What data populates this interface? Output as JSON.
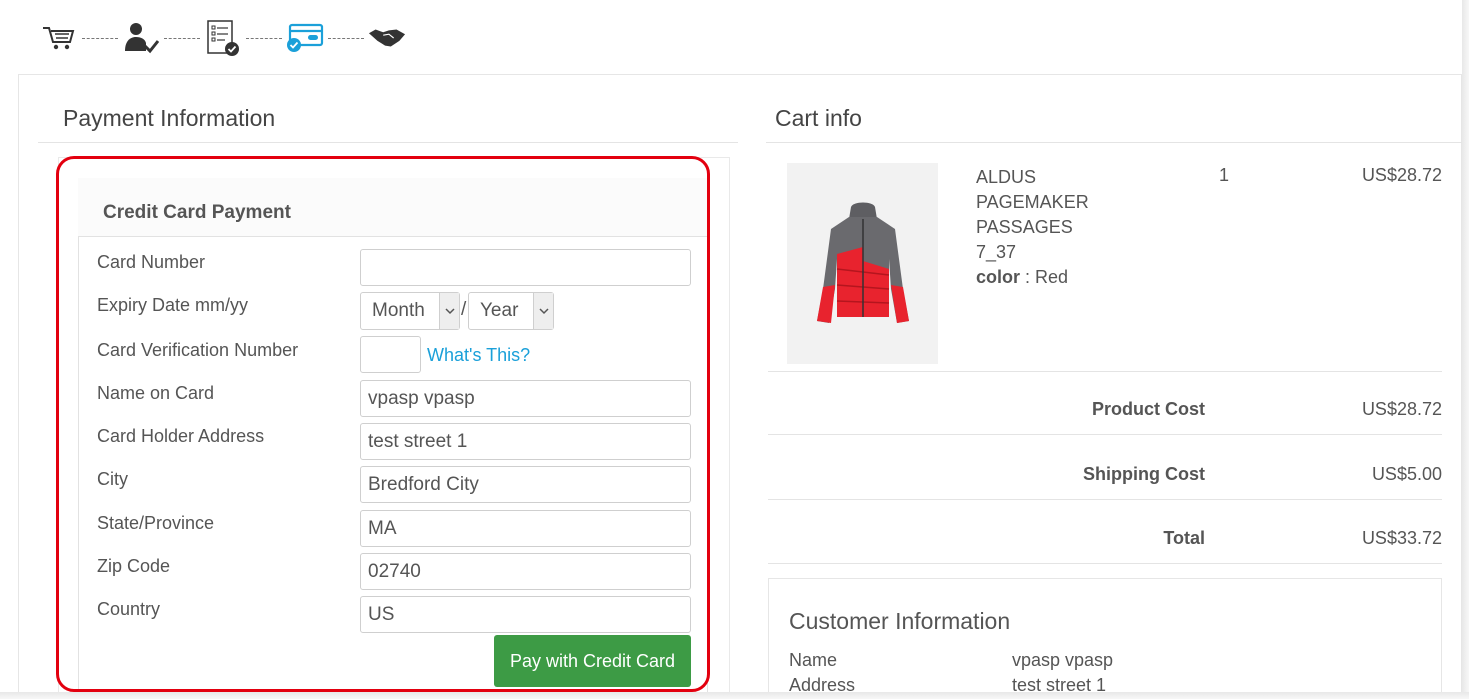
{
  "steps": [
    {
      "icon": "cart-icon"
    },
    {
      "icon": "user-check-icon"
    },
    {
      "icon": "checklist-icon"
    },
    {
      "icon": "credit-card-check-icon",
      "active": true
    },
    {
      "icon": "handshake-icon"
    }
  ],
  "colors": {
    "accent_blue": "#1ba0d9",
    "pay_button": "#3d9b45",
    "highlight_red": "#e3000f"
  },
  "payment": {
    "title": "Payment Information",
    "card_title": "Credit Card Payment",
    "fields": {
      "card_number": {
        "label": "Card Number",
        "value": ""
      },
      "expiry": {
        "label": "Expiry Date mm/yy",
        "month": "Month",
        "year": "Year",
        "separator": "/"
      },
      "cvv": {
        "label": "Card Verification Number",
        "value": "",
        "help_link": "What's This?"
      },
      "name": {
        "label": "Name on Card",
        "value": "vpasp vpasp"
      },
      "address": {
        "label": "Card Holder Address",
        "value": "test street 1"
      },
      "city": {
        "label": "City",
        "value": "Bredford City"
      },
      "state": {
        "label": "State/Province",
        "value": "MA"
      },
      "zip": {
        "label": "Zip Code",
        "value": "02740"
      },
      "country": {
        "label": "Country",
        "value": "US"
      }
    },
    "pay_button": "Pay with Credit Card"
  },
  "cart": {
    "title": "Cart info",
    "item": {
      "name_lines": [
        "ALDUS",
        "PAGEMAKER",
        "PASSAGES",
        "7_37"
      ],
      "option_label": "color",
      "option_sep": " : ",
      "option_value": "Red",
      "qty": "1",
      "price": "US$28.72"
    },
    "summary": {
      "product_cost_label": "Product Cost",
      "product_cost": "US$28.72",
      "shipping_label": "Shipping Cost",
      "shipping": "US$5.00",
      "total_label": "Total",
      "total": "US$33.72"
    }
  },
  "customer": {
    "title": "Customer Information",
    "name_label": "Name",
    "name": "vpasp vpasp",
    "address_label": "Address",
    "address": "test street 1"
  }
}
